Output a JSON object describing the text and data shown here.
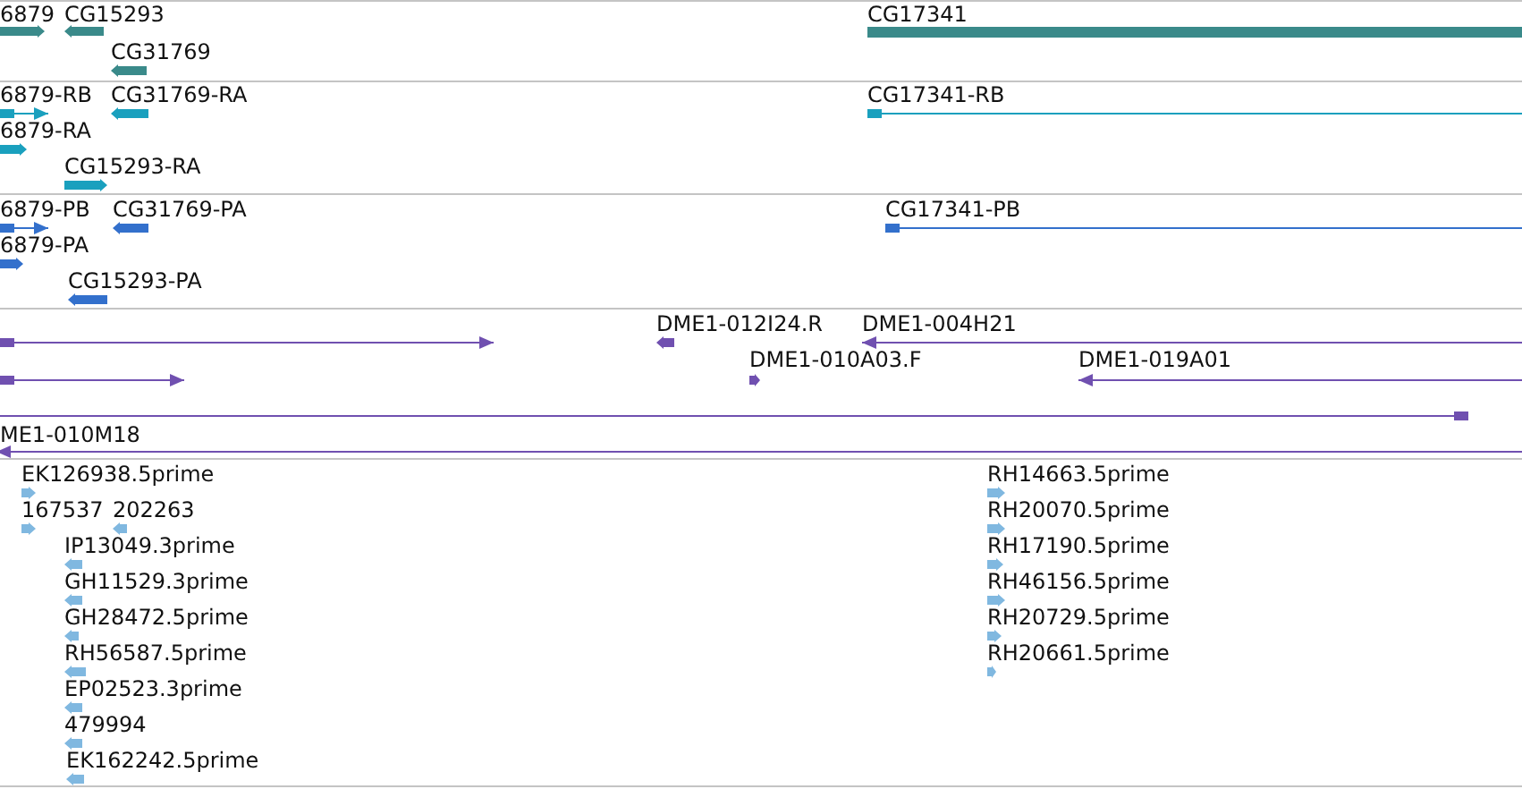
{
  "tracks": [
    {
      "color": "#3a8a8a",
      "features": [
        {
          "label": "6879",
          "kind": "block",
          "reverse": false
        },
        {
          "label": "CG15293",
          "kind": "block",
          "reverse": true
        },
        {
          "label": "CG31769",
          "kind": "block",
          "reverse": true
        },
        {
          "label": "CG17341",
          "kind": "bar"
        }
      ]
    },
    {
      "color": "#1aa0be",
      "features": [
        {
          "label": "6879-RB",
          "kind": "line",
          "reverse": false
        },
        {
          "label": "CG31769-RA",
          "kind": "block",
          "reverse": true
        },
        {
          "label": "6879-RA",
          "kind": "block",
          "reverse": false
        },
        {
          "label": "CG15293-RA",
          "kind": "block",
          "reverse": false
        },
        {
          "label": "CG17341-RB",
          "kind": "line",
          "reverse": false
        }
      ]
    },
    {
      "color": "#3370cc",
      "features": [
        {
          "label": "6879-PB",
          "kind": "line",
          "reverse": false
        },
        {
          "label": "CG31769-PA",
          "kind": "block",
          "reverse": true
        },
        {
          "label": "6879-PA",
          "kind": "block",
          "reverse": false
        },
        {
          "label": "CG15293-PA",
          "kind": "block",
          "reverse": true
        },
        {
          "label": "CG17341-PB",
          "kind": "line",
          "reverse": false
        }
      ]
    },
    {
      "color": "#7050b0",
      "features": [
        {
          "kind": "line",
          "reverse": false
        },
        {
          "label": "DME1-012I24.R",
          "kind": "block",
          "reverse": true
        },
        {
          "label": "DME1-004H21",
          "kind": "line",
          "reverse": true
        },
        {
          "kind": "line",
          "reverse": false
        },
        {
          "label": "DME1-010A03.F",
          "kind": "block",
          "reverse": false
        },
        {
          "label": "DME1-019A01",
          "kind": "line",
          "reverse": true
        },
        {
          "kind": "line",
          "reverse": true
        },
        {
          "label": "ME1-010M18",
          "kind": "line",
          "reverse": true
        }
      ]
    },
    {
      "color": "#80b8e0",
      "features": [
        {
          "label": "EK126938.5prime",
          "kind": "block",
          "reverse": false
        },
        {
          "label": "167537",
          "kind": "block",
          "reverse": false
        },
        {
          "label": "202263",
          "kind": "block",
          "reverse": true
        },
        {
          "label": "IP13049.3prime",
          "kind": "block",
          "reverse": true
        },
        {
          "label": "GH11529.3prime",
          "kind": "block",
          "reverse": true
        },
        {
          "label": "GH28472.5prime",
          "kind": "block",
          "reverse": true
        },
        {
          "label": "RH56587.5prime",
          "kind": "block",
          "reverse": true
        },
        {
          "label": "EP02523.3prime",
          "kind": "block",
          "reverse": true
        },
        {
          "label": "479994",
          "kind": "block",
          "reverse": true
        },
        {
          "label": "EK162242.5prime",
          "kind": "block",
          "reverse": true
        },
        {
          "label": "RH14663.5prime",
          "kind": "block",
          "reverse": false
        },
        {
          "label": "RH20070.5prime",
          "kind": "block",
          "reverse": false
        },
        {
          "label": "RH17190.5prime",
          "kind": "block",
          "reverse": false
        },
        {
          "label": "RH46156.5prime",
          "kind": "block",
          "reverse": false
        },
        {
          "label": "RH20729.5prime",
          "kind": "block",
          "reverse": false
        },
        {
          "label": "RH20661.5prime",
          "kind": "block",
          "reverse": false
        }
      ]
    }
  ]
}
